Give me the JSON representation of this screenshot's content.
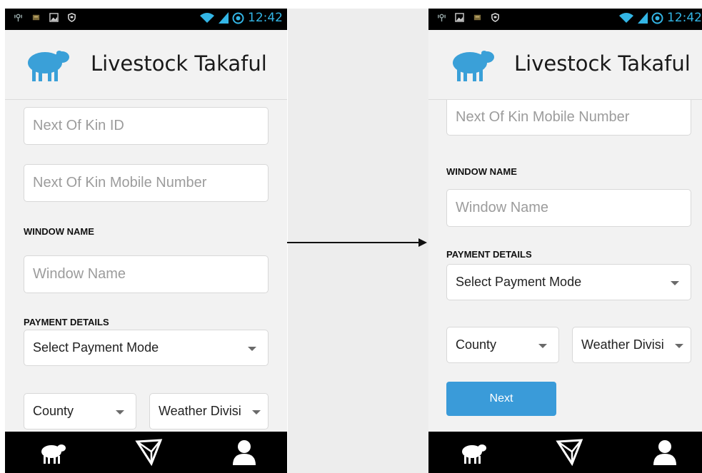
{
  "app": {
    "title": "Livestock Takaful"
  },
  "status_bar": {
    "time": "12:42"
  },
  "colors": {
    "accent": "#33b5e5",
    "button": "#3a9bd9",
    "logo": "#3aa0d8"
  },
  "icons": {
    "status_left": [
      "usb-debug-icon",
      "notification-icon",
      "gallery-icon",
      "shield-icon"
    ],
    "status_right": [
      "wifi-icon",
      "signal-icon",
      "sync-icon"
    ],
    "nav": [
      "sheep-icon",
      "map-pin-icon",
      "user-icon"
    ]
  },
  "screen_before": {
    "next_of_kin_id_placeholder": "Next Of Kin ID",
    "next_of_kin_mobile_placeholder": "Next Of Kin Mobile Number",
    "window_name_label": "WINDOW NAME",
    "window_name_placeholder": "Window Name",
    "payment_details_label": "PAYMENT DETAILS",
    "payment_mode_value": "Select Payment Mode",
    "county_value": "County",
    "weather_division_value": "Weather Divisi"
  },
  "screen_after": {
    "next_of_kin_mobile_placeholder": "Next Of Kin Mobile Number",
    "window_name_label": "WINDOW NAME",
    "window_name_placeholder": "Window Name",
    "payment_details_label": "PAYMENT DETAILS",
    "payment_mode_value": "Select Payment Mode",
    "county_value": "County",
    "weather_division_value": "Weather Divisi",
    "next_button_label": "Next"
  }
}
